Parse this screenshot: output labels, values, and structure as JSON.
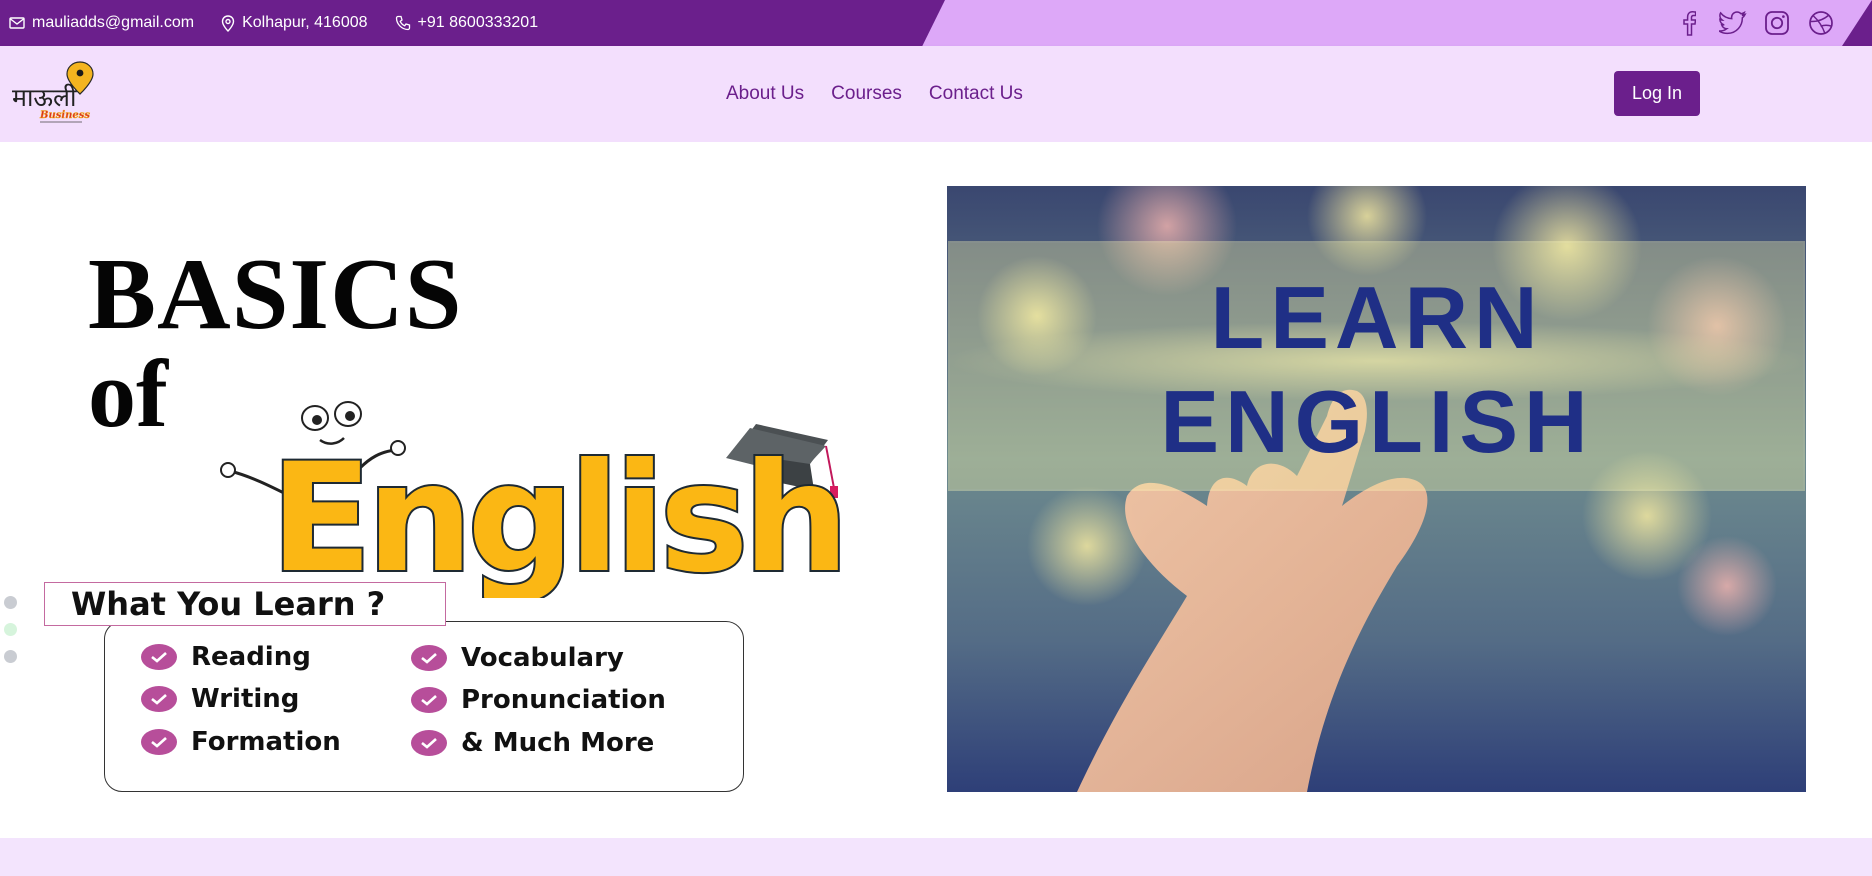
{
  "topbar": {
    "email": "mauliadds@gmail.com",
    "location": "Kolhapur, 416008",
    "phone": "+91 8600333201",
    "social": [
      "facebook-icon",
      "twitter-icon",
      "instagram-icon",
      "dribbble-icon"
    ]
  },
  "navbar": {
    "logo_text": "माऊली",
    "logo_subtext": "Business",
    "links": [
      "About Us",
      "Courses",
      "Contact Us"
    ],
    "login_label": "Log In"
  },
  "hero": {
    "title_line1": "BASICS",
    "title_line2": "of",
    "title_word": "English",
    "what_you_learn": "What You Learn ?",
    "items_left": [
      "Reading",
      "Writing",
      "Formation"
    ],
    "items_right": [
      "Vocabulary",
      "Pronunciation",
      "& Much More"
    ],
    "photo_text_line1": "LEARN",
    "photo_text_line2": "ENGLISH"
  },
  "colors": {
    "brand_purple": "#6b1f8c",
    "topbar_light": "#dda8f8",
    "navbar_bg": "#f3dffd",
    "english_yellow": "#fbb714",
    "check_pink": "#b74e9a",
    "photo_text_blue": "#1f2f86"
  }
}
